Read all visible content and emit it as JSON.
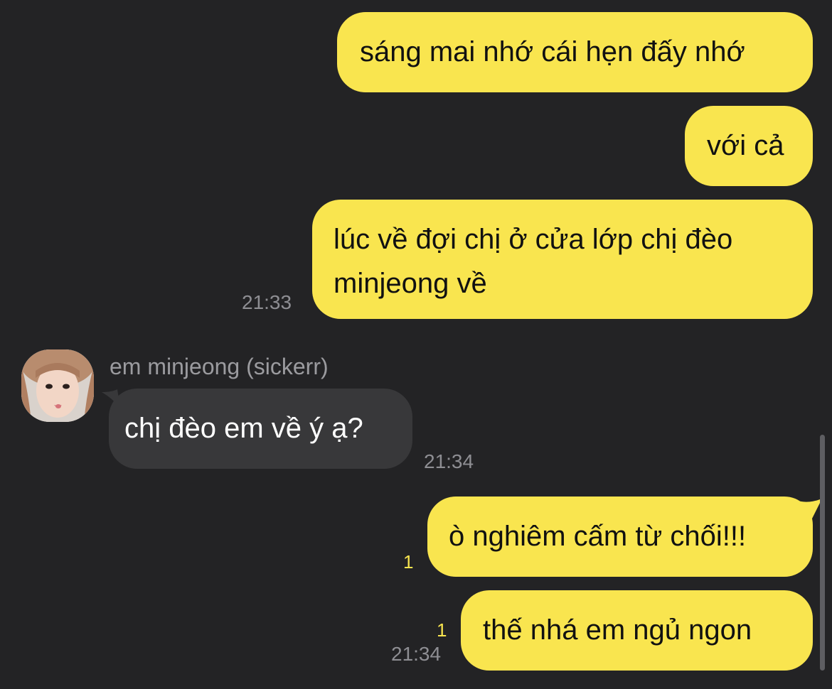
{
  "messages": [
    {
      "id": "m1",
      "direction": "out",
      "text": "sáng mai nhớ cái hẹn đấy nhớ"
    },
    {
      "id": "m2",
      "direction": "out",
      "text": "với cả"
    },
    {
      "id": "m3",
      "direction": "out",
      "line1": "lúc về đợi chị ở cửa lớp chị đèo",
      "line2": "minjeong về",
      "time": "21:33"
    },
    {
      "id": "m4",
      "direction": "in",
      "sender": "em minjeong (sickerr)",
      "text": "chị đèo em về ý ạ?",
      "time": "21:34"
    },
    {
      "id": "m5",
      "direction": "out",
      "text": "ò nghiêm cấm từ chối!!!",
      "unread": "1"
    },
    {
      "id": "m6",
      "direction": "out",
      "text": "thế nhá em ngủ ngon",
      "unread": "1",
      "time": "21:34"
    }
  ],
  "colors": {
    "background": "#232325",
    "outgoing_bubble": "#F9E54F",
    "incoming_bubble": "#38383A",
    "timestamp": "#8E8E93",
    "unread_count": "#F9E54F"
  }
}
